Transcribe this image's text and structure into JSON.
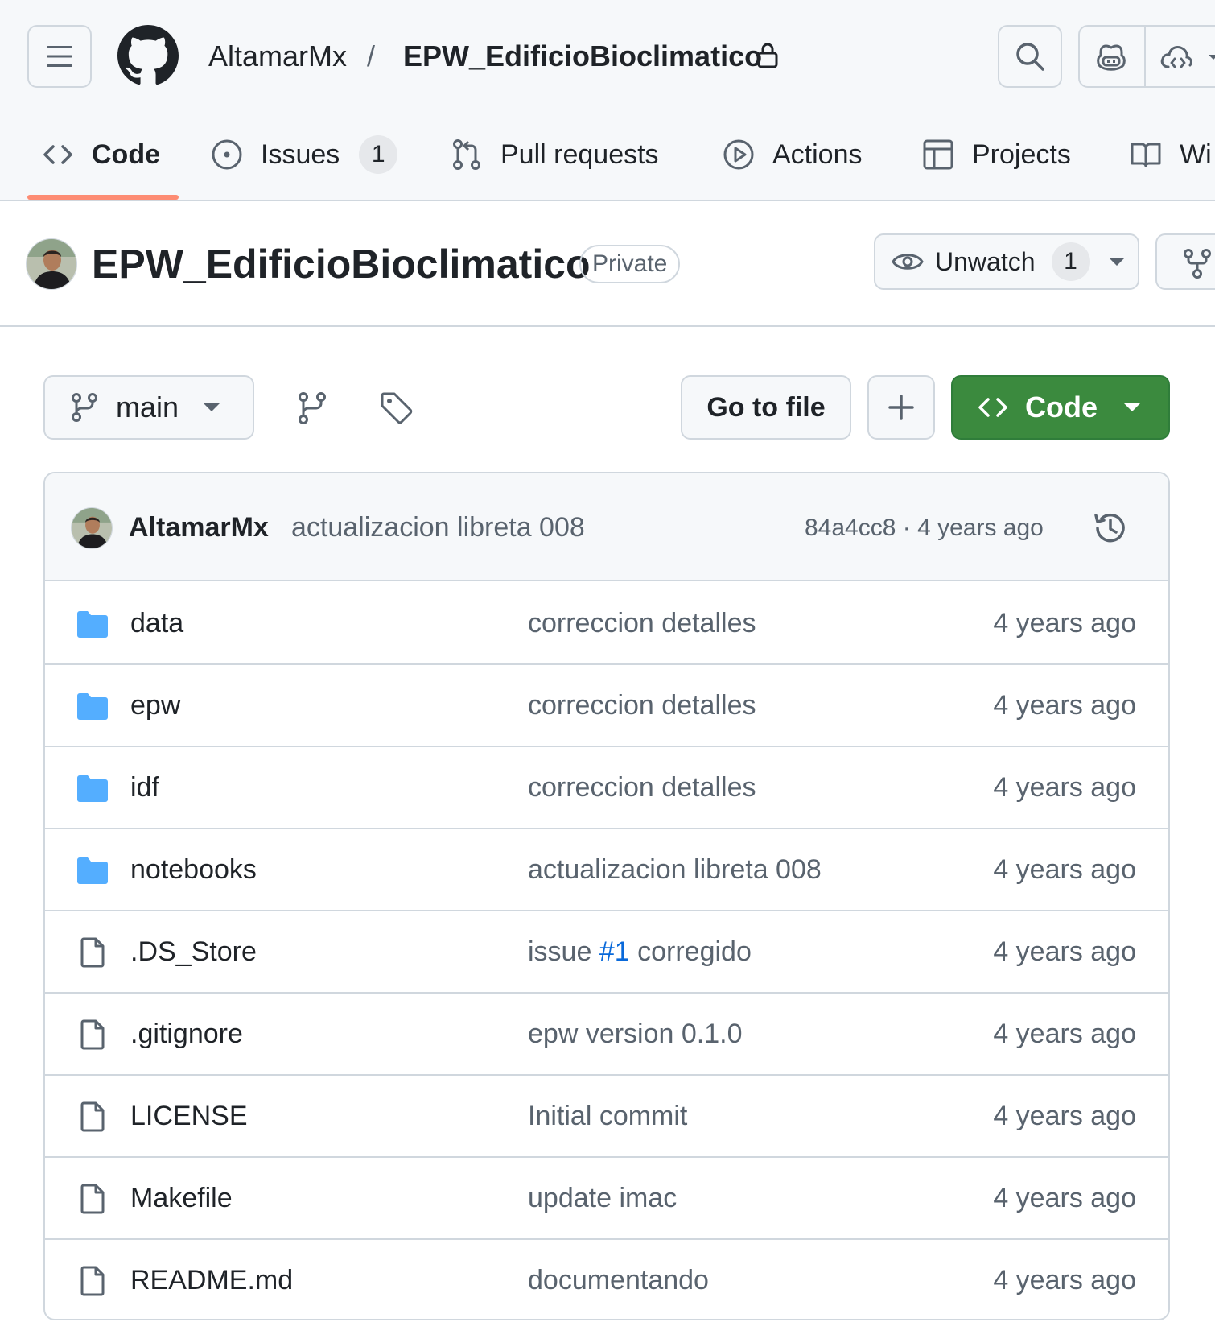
{
  "header": {
    "owner": "AltamarMx",
    "separator": "/",
    "repo": "EPW_EdificioBioclimatico"
  },
  "tabs": [
    {
      "label": "Code",
      "icon": "code-icon",
      "selected": true
    },
    {
      "label": "Issues",
      "icon": "issue-icon",
      "count": "1"
    },
    {
      "label": "Pull requests",
      "icon": "pull-request-icon"
    },
    {
      "label": "Actions",
      "icon": "play-icon"
    },
    {
      "label": "Projects",
      "icon": "table-icon"
    },
    {
      "label": "Wi",
      "icon": "book-icon"
    }
  ],
  "repo": {
    "title": "EPW_EdificioBioclimatico",
    "visibility": "Private",
    "watch_label": "Unwatch",
    "watch_count": "1"
  },
  "toolbar": {
    "branch": "main",
    "goto_file": "Go to file",
    "code_button": "Code"
  },
  "latest_commit": {
    "author": "AltamarMx",
    "message": "actualizacion libreta 008",
    "meta": "84a4cc8 · 4 years ago"
  },
  "files": [
    {
      "type": "dir",
      "name": "data",
      "commit": "correccion detalles",
      "age": "4 years ago"
    },
    {
      "type": "dir",
      "name": "epw",
      "commit": "correccion detalles",
      "age": "4 years ago"
    },
    {
      "type": "dir",
      "name": "idf",
      "commit": "correccion detalles",
      "age": "4 years ago"
    },
    {
      "type": "dir",
      "name": "notebooks",
      "commit": "actualizacion libreta 008",
      "age": "4 years ago"
    },
    {
      "type": "file",
      "name": ".DS_Store",
      "commit_pre": "issue ",
      "commit_link": "#1",
      "commit_post": " corregido",
      "age": "4 years ago"
    },
    {
      "type": "file",
      "name": ".gitignore",
      "commit": "epw version 0.1.0",
      "age": "4 years ago"
    },
    {
      "type": "file",
      "name": "LICENSE",
      "commit": "Initial commit",
      "age": "4 years ago"
    },
    {
      "type": "file",
      "name": "Makefile",
      "commit": "update imac",
      "age": "4 years ago"
    },
    {
      "type": "file",
      "name": "README.md",
      "commit": "documentando",
      "age": "4 years ago"
    }
  ],
  "colors": {
    "accent_green": "#3b8a3e",
    "tab_underline": "#fd8c73",
    "folder_blue": "#54aeff",
    "link_blue": "#0969da"
  }
}
